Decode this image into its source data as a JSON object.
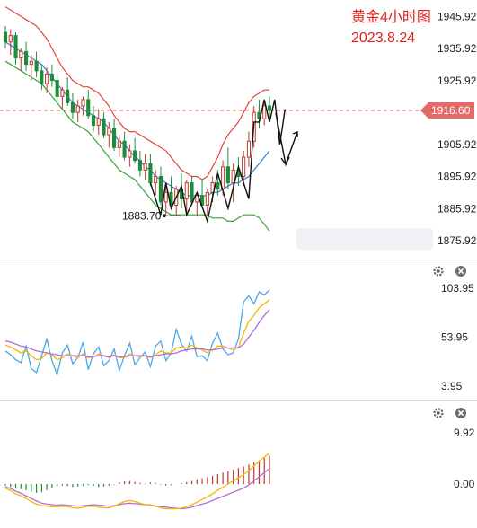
{
  "chart_data": [
    {
      "type": "candlestick",
      "title": "黄金4小时图",
      "subtitle": "2023.8.24",
      "y_ticks": [
        "1945.92",
        "1935.92",
        "1925.92",
        "1905.92",
        "1895.92",
        "1885.92",
        "1875.92"
      ],
      "current_price": "1916.60",
      "low_annotation": "1883.70",
      "ylim": [
        1872,
        1950
      ],
      "candles": [
        [
          1941,
          1943,
          1936,
          1938
        ],
        [
          1938,
          1942,
          1934,
          1940
        ],
        [
          1940,
          1941,
          1931,
          1933
        ],
        [
          1933,
          1936,
          1929,
          1935
        ],
        [
          1935,
          1938,
          1929,
          1931
        ],
        [
          1931,
          1934,
          1926,
          1932
        ],
        [
          1932,
          1935,
          1927,
          1929
        ],
        [
          1929,
          1931,
          1923,
          1925
        ],
        [
          1925,
          1930,
          1922,
          1928
        ],
        [
          1928,
          1931,
          1924,
          1926
        ],
        [
          1926,
          1928,
          1919,
          1921
        ],
        [
          1921,
          1924,
          1917,
          1923
        ],
        [
          1923,
          1927,
          1918,
          1919
        ],
        [
          1919,
          1922,
          1914,
          1916
        ],
        [
          1916,
          1920,
          1913,
          1918
        ],
        [
          1918,
          1921,
          1915,
          1920
        ],
        [
          1920,
          1923,
          1914,
          1915
        ],
        [
          1915,
          1918,
          1910,
          1912
        ],
        [
          1912,
          1917,
          1909,
          1914
        ],
        [
          1914,
          1916,
          1908,
          1909
        ],
        [
          1909,
          1913,
          1905,
          1911
        ],
        [
          1911,
          1914,
          1904,
          1905
        ],
        [
          1905,
          1909,
          1902,
          1907
        ],
        [
          1907,
          1910,
          1901,
          1902
        ],
        [
          1902,
          1906,
          1899,
          1904
        ],
        [
          1904,
          1908,
          1900,
          1901
        ],
        [
          1901,
          1904,
          1896,
          1898
        ],
        [
          1898,
          1903,
          1895,
          1900
        ],
        [
          1900,
          1903,
          1893,
          1894
        ],
        [
          1894,
          1898,
          1890,
          1896
        ],
        [
          1896,
          1899,
          1887,
          1888
        ],
        [
          1888,
          1893,
          1884,
          1891
        ],
        [
          1891,
          1896,
          1886,
          1887
        ],
        [
          1887,
          1893,
          1884,
          1892
        ],
        [
          1892,
          1897,
          1886,
          1889
        ],
        [
          1889,
          1895,
          1885,
          1894
        ],
        [
          1894,
          1896,
          1887,
          1888
        ],
        [
          1888,
          1891,
          1883.7,
          1890
        ],
        [
          1890,
          1895,
          1886,
          1887
        ],
        [
          1887,
          1892,
          1884,
          1891
        ],
        [
          1891,
          1896,
          1888,
          1894
        ],
        [
          1894,
          1898,
          1890,
          1892
        ],
        [
          1892,
          1901,
          1890,
          1899
        ],
        [
          1899,
          1905,
          1892,
          1894
        ],
        [
          1894,
          1900,
          1888,
          1898
        ],
        [
          1898,
          1902,
          1893,
          1896
        ],
        [
          1896,
          1904,
          1893,
          1902
        ],
        [
          1902,
          1910,
          1899,
          1907
        ],
        [
          1907,
          1918,
          1905,
          1916
        ],
        [
          1916,
          1920,
          1911,
          1914
        ],
        [
          1914,
          1920,
          1912,
          1918
        ],
        [
          1918,
          1921,
          1914,
          1916.6
        ]
      ],
      "bands": {
        "upper": [
          1949,
          1948,
          1947,
          1946,
          1945,
          1944,
          1943,
          1941,
          1939,
          1936,
          1933,
          1930,
          1928,
          1926,
          1925,
          1924,
          1924,
          1923,
          1922,
          1920,
          1918,
          1915,
          1913,
          1911,
          1910,
          1910,
          1909,
          1908,
          1907,
          1906,
          1905,
          1904,
          1902,
          1900,
          1898,
          1897,
          1896,
          1896,
          1895,
          1896,
          1899,
          1902,
          1906,
          1909,
          1911,
          1913,
          1916,
          1919,
          1921,
          1922,
          1923,
          1923
        ],
        "middle": [
          1938,
          1937,
          1936,
          1935,
          1934,
          1933,
          1932,
          1931,
          1929,
          1927,
          1925,
          1923,
          1921,
          1919,
          1918,
          1917,
          1916,
          1915,
          1914,
          1913,
          1911,
          1909,
          1907,
          1906,
          1904,
          1902,
          1901,
          1899,
          1898,
          1896,
          1895,
          1894,
          1893,
          1892,
          1891,
          1890,
          1890,
          1890,
          1890,
          1890,
          1891,
          1891,
          1892,
          1893,
          1894,
          1894,
          1895,
          1896,
          1898,
          1900,
          1902,
          1904
        ],
        "lower": [
          1932,
          1931,
          1930,
          1929,
          1928,
          1927,
          1926,
          1925,
          1923,
          1921,
          1919,
          1917,
          1915,
          1913,
          1912,
          1911,
          1910,
          1908,
          1906,
          1904,
          1902,
          1900,
          1898,
          1897,
          1896,
          1895,
          1893,
          1891,
          1889,
          1887,
          1886,
          1885,
          1884,
          1884,
          1884,
          1884,
          1884,
          1884,
          1884,
          1884,
          1883,
          1883,
          1883,
          1882,
          1882,
          1883,
          1884,
          1884,
          1884,
          1883,
          1881,
          1879
        ]
      },
      "zigzag": [
        [
          28,
          1894
        ],
        [
          30,
          1884
        ],
        [
          31,
          1894
        ],
        [
          32,
          1886
        ],
        [
          34,
          1893
        ],
        [
          35,
          1884
        ],
        [
          37,
          1891
        ],
        [
          39,
          1882
        ],
        [
          41,
          1897
        ],
        [
          43,
          1886
        ],
        [
          45,
          1899
        ],
        [
          47,
          1889
        ],
        [
          48,
          1913
        ],
        [
          49,
          1913
        ],
        [
          50,
          1920
        ],
        [
          51,
          1913
        ],
        [
          52,
          1920
        ],
        [
          53,
          1906
        ],
        [
          54,
          1917
        ]
      ]
    },
    {
      "type": "line",
      "y_ticks": [
        "103.95",
        "53.95",
        "3.95"
      ],
      "ylim": [
        -5,
        112
      ],
      "series": [
        {
          "color": "#4aa8e8",
          "values": [
            40,
            36,
            31,
            28,
            45,
            22,
            18,
            35,
            52,
            30,
            16,
            38,
            46,
            27,
            33,
            49,
            21,
            37,
            44,
            25,
            30,
            42,
            20,
            35,
            48,
            26,
            33,
            39,
            24,
            45,
            50,
            30,
            38,
            62,
            47,
            40,
            55,
            34,
            35,
            30,
            48,
            58,
            42,
            36,
            38,
            52,
            90,
            96,
            88,
            100,
            97,
            102
          ]
        },
        {
          "color": "#f5b800",
          "values": [
            46,
            44,
            41,
            38,
            40,
            35,
            31,
            32,
            38,
            36,
            31,
            33,
            37,
            35,
            33,
            37,
            33,
            34,
            37,
            35,
            33,
            36,
            33,
            33,
            37,
            35,
            34,
            35,
            33,
            36,
            40,
            38,
            38,
            43,
            44,
            43,
            46,
            43,
            41,
            38,
            41,
            45,
            45,
            43,
            41,
            44,
            58,
            70,
            76,
            84,
            88,
            92
          ]
        },
        {
          "color": "#b36cd9",
          "values": [
            50,
            49,
            47,
            45,
            44,
            42,
            40,
            39,
            38,
            37,
            36,
            35,
            35,
            35,
            35,
            35,
            34,
            34,
            35,
            35,
            34,
            35,
            34,
            34,
            35,
            35,
            35,
            35,
            34,
            35,
            36,
            37,
            37,
            38,
            40,
            41,
            42,
            42,
            42,
            41,
            41,
            42,
            43,
            43,
            43,
            43,
            47,
            54,
            61,
            69,
            76,
            82
          ]
        }
      ]
    },
    {
      "type": "bar",
      "y_ticks": [
        "9.92",
        "0.00"
      ],
      "ylim": [
        -8,
        12
      ],
      "histogram": [
        -0.3,
        -0.6,
        -0.9,
        -1.0,
        -1.2,
        -1.5,
        -1.7,
        -1.6,
        -1.2,
        -0.8,
        -0.5,
        -0.3,
        -0.4,
        -0.6,
        -0.5,
        -0.3,
        -0.2,
        -0.4,
        -0.6,
        -0.5,
        -0.3,
        -0.1,
        0.3,
        0.5,
        0.6,
        0.4,
        0.2,
        0.1,
        0.3,
        0.2,
        -0.1,
        -0.3,
        -0.2,
        0.0,
        0.2,
        0.4,
        0.6,
        0.9,
        1.1,
        1.3,
        1.6,
        1.9,
        2.2,
        2.5,
        2.8,
        3.1,
        3.4,
        3.8,
        4.2,
        4.6,
        5.0,
        5.5
      ],
      "lines": [
        {
          "color": "#b36cd9",
          "values": [
            -0.5,
            -0.9,
            -1.4,
            -1.8,
            -2.3,
            -2.8,
            -3.3,
            -3.7,
            -3.9,
            -4.0,
            -4.1,
            -4.0,
            -4.1,
            -4.2,
            -4.3,
            -4.2,
            -4.1,
            -4.0,
            -4.1,
            -4.2,
            -4.3,
            -4.2,
            -4.0,
            -3.8,
            -3.7,
            -3.8,
            -3.9,
            -4.0,
            -4.1,
            -4.3,
            -4.4,
            -4.5,
            -4.6,
            -4.7,
            -4.8,
            -4.7,
            -4.5,
            -4.2,
            -3.9,
            -3.6,
            -3.2,
            -2.8,
            -2.4,
            -2.0,
            -1.6,
            -1.2,
            -0.8,
            -0.2,
            0.6,
            1.4,
            2.2,
            3.0
          ]
        },
        {
          "color": "#f5b800",
          "values": [
            -0.8,
            -1.3,
            -1.9,
            -2.3,
            -2.8,
            -3.4,
            -3.9,
            -4.2,
            -4.3,
            -4.4,
            -4.4,
            -4.3,
            -4.4,
            -4.6,
            -4.7,
            -4.5,
            -4.3,
            -4.3,
            -4.5,
            -4.6,
            -4.6,
            -4.3,
            -3.8,
            -3.4,
            -3.2,
            -3.4,
            -3.7,
            -4.0,
            -4.0,
            -4.3,
            -4.6,
            -4.8,
            -4.8,
            -4.8,
            -4.7,
            -4.4,
            -4.0,
            -3.5,
            -3.0,
            -2.5,
            -1.9,
            -1.2,
            -0.6,
            0.0,
            0.6,
            1.2,
            1.8,
            2.6,
            3.5,
            4.4,
            5.2,
            6.0
          ]
        }
      ]
    }
  ]
}
